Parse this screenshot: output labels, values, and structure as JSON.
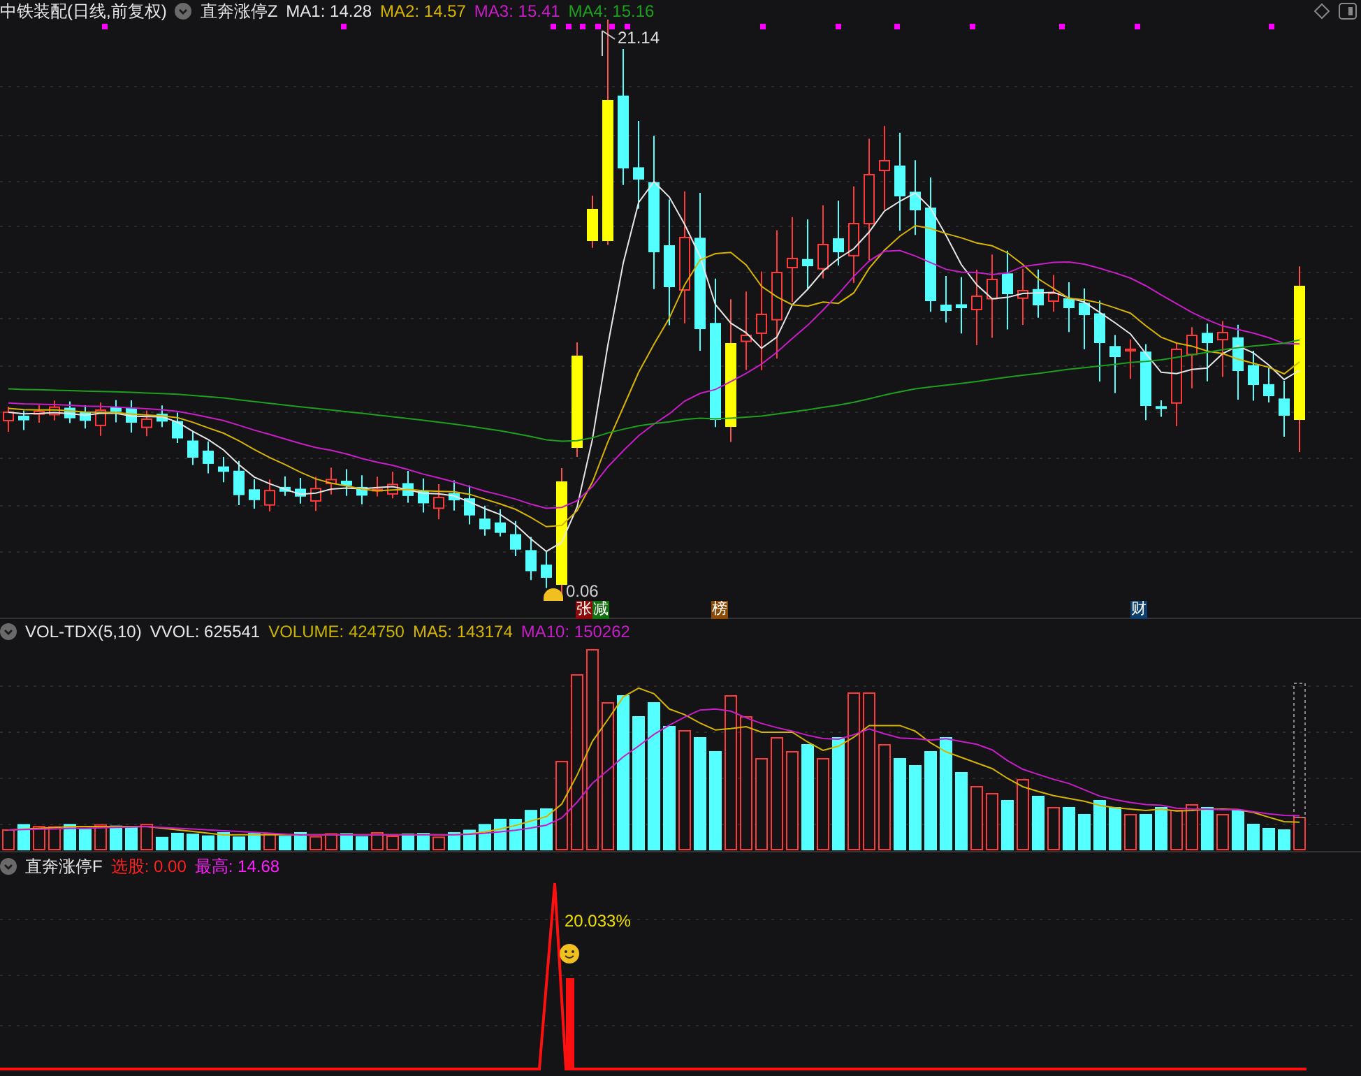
{
  "header": {
    "stock": "中铁装配(日线,前复权)",
    "indicator": "直奔涨停Z"
  },
  "legend": [
    {
      "label": "MA1: 14.28",
      "color": "#e6e6e6"
    },
    {
      "label": "MA2: 14.57",
      "color": "#d6b400"
    },
    {
      "label": "MA3: 15.41",
      "color": "#c81ec8"
    },
    {
      "label": "MA4: 15.16",
      "color": "#1ea01e"
    }
  ],
  "price_labels": {
    "high": "21.14",
    "low": "0.06"
  },
  "event_tags": [
    {
      "text": "张",
      "color": "#8b0a0a"
    },
    {
      "text": "减",
      "color": "#137013"
    },
    {
      "text": "榜",
      "color": "#8a4a08"
    },
    {
      "text": "财",
      "color": "#103f6e"
    }
  ],
  "volume_panel": {
    "title": "VOL-TDX(5,10)",
    "legend": [
      {
        "label": "VVOL: 625541",
        "color": "#e6e6e6"
      },
      {
        "label": "VOLUME: 424750",
        "color": "#c8b400"
      },
      {
        "label": "MA5: 143174",
        "color": "#d6b400"
      },
      {
        "label": "MA10: 150262",
        "color": "#c81ec8"
      }
    ]
  },
  "indicator_panel": {
    "title": "直奔涨停F",
    "legend": [
      {
        "label": "选股: 0.00",
        "color": "#ff2020"
      },
      {
        "label": "最高: 14.68",
        "color": "#ff20ff"
      }
    ],
    "annotation": "20.033%"
  }
}
